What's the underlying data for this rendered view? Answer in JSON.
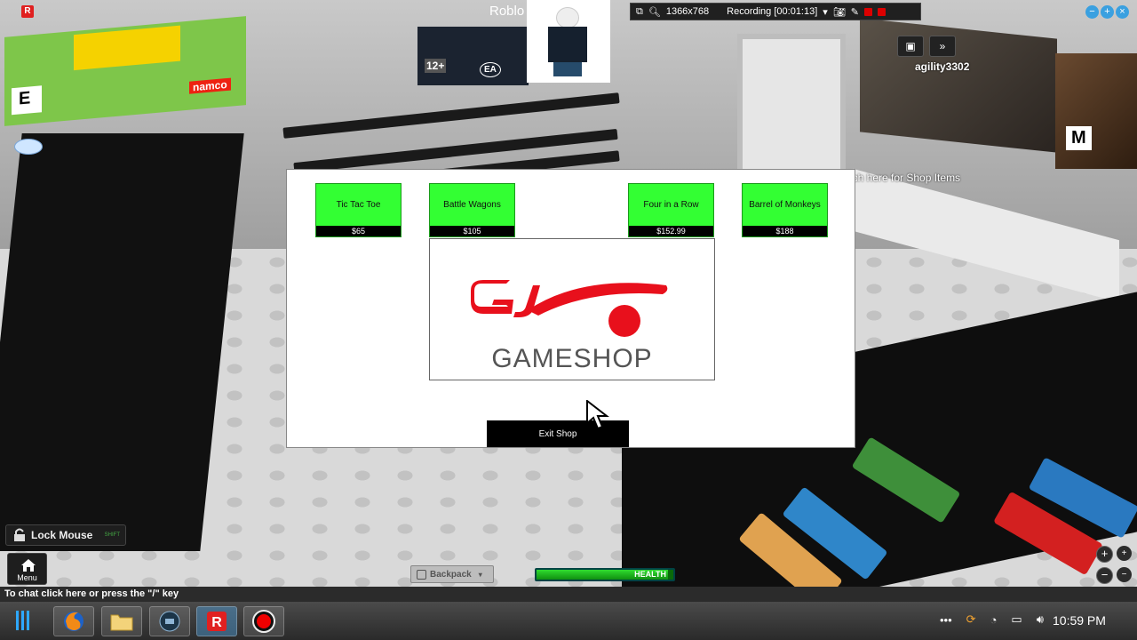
{
  "window": {
    "title": "Roblo"
  },
  "recorder": {
    "resolution": "1366x768",
    "status": "Recording [00:01:13]"
  },
  "player": {
    "name": "agility3302"
  },
  "hint": {
    "shop_prompt": "ich here for Shop Items"
  },
  "shop": {
    "items": [
      {
        "name": "Tic Tac Toe",
        "price": "$65"
      },
      {
        "name": "Battle Wagons",
        "price": "$105"
      },
      {
        "name": "Four in a Row",
        "price": "$152.99"
      },
      {
        "name": "Barrel of Monkeys",
        "price": "$188"
      }
    ],
    "logo": {
      "wordmark": "GAMESHOP",
      "brand_color": "#e8101c"
    },
    "exit_label": "Exit Shop"
  },
  "hud": {
    "lock_mouse_label": "Lock Mouse",
    "lock_mouse_hint": "SHIFT",
    "menu_label": "Menu",
    "backpack_label": "Backpack",
    "health_label": "HEALTH",
    "health_fraction": 0.96,
    "zoom_in": "+",
    "zoom_out": "−"
  },
  "chat": {
    "prompt": "To chat click here or press the \"/\" key"
  },
  "taskbar": {
    "apps": [
      "firefox-icon",
      "folder-icon",
      "media-icon",
      "roblox-icon",
      "record-icon"
    ],
    "time": "10:59 PM",
    "tray_more": "•••"
  },
  "posters": {
    "rating_e": "E",
    "rating_12": "12+",
    "rating_m": "M",
    "namco": "namco",
    "ea": "EA"
  }
}
